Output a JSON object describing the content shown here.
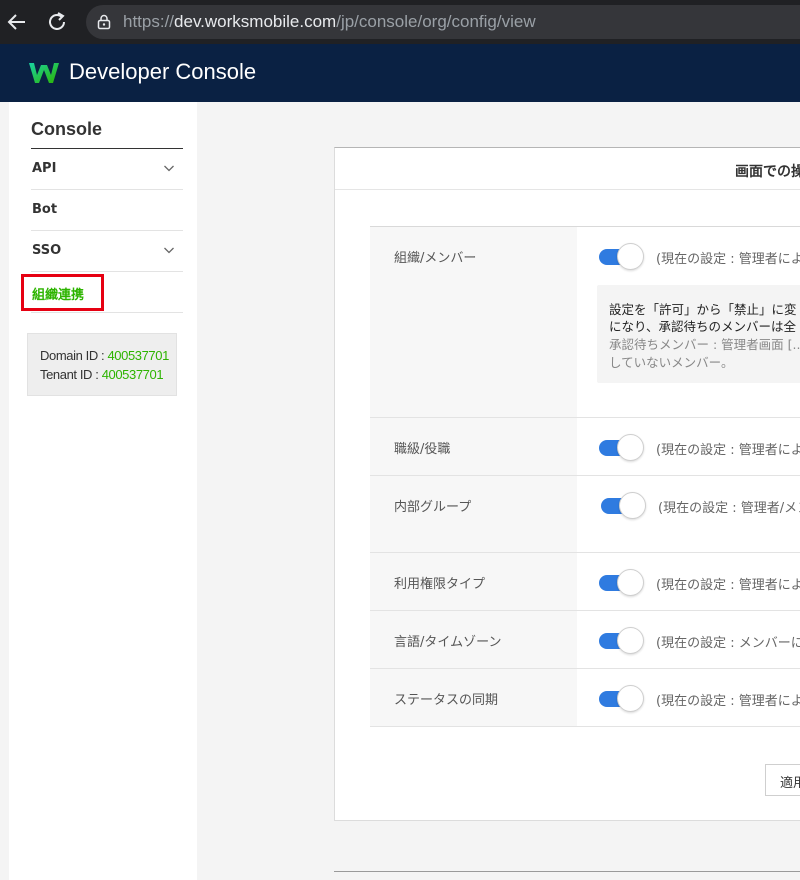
{
  "browser": {
    "url_scheme": "https://",
    "url_host": "dev.worksmobile.com",
    "url_path": "/jp/console/org/config/view"
  },
  "header": {
    "title": "Developer Console",
    "logo": "works-w-logo"
  },
  "sidebar": {
    "title": "Console",
    "items": [
      {
        "label": "API",
        "has_chevron": true
      },
      {
        "label": "Bot",
        "has_chevron": false
      },
      {
        "label": "SSO",
        "has_chevron": true
      },
      {
        "label": "組織連携",
        "active": true
      }
    ],
    "domain_label": "Domain ID : ",
    "domain_id": "400537701",
    "tenant_label": "Tenant ID : ",
    "tenant_id": "400537701"
  },
  "panel": {
    "title": "画面での操",
    "rows": [
      {
        "label": "組織/メンバー",
        "status": "(現在の設定 : 管理者によ",
        "enabled": true
      },
      {
        "label": "職級/役職",
        "status": "(現在の設定 : 管理者によ",
        "enabled": true
      },
      {
        "label": "内部グループ",
        "status": "(現在の設定 : 管理者/メン",
        "enabled": true
      },
      {
        "label": "利用権限タイプ",
        "status": "(現在の設定 : 管理者によ",
        "enabled": true
      },
      {
        "label": "言語/タイムゾーン",
        "status": "(現在の設定 : メンバーに",
        "enabled": true
      },
      {
        "label": "ステータスの同期",
        "status": "(現在の設定 : 管理者によ",
        "enabled": true
      }
    ],
    "note": {
      "line1": "設定を「許可」から「禁止」に変",
      "line2": "になり、承認待ちのメンバーは全",
      "line3": "承認待ちメンバー : 管理者画面 [..",
      "line4": "していないメンバー。"
    },
    "apply_label": "適用"
  },
  "colors": {
    "accent_green": "#2db400",
    "header_navy": "#0a2143",
    "toggle_blue": "#2f7be0",
    "highlight_red": "#e60012"
  }
}
